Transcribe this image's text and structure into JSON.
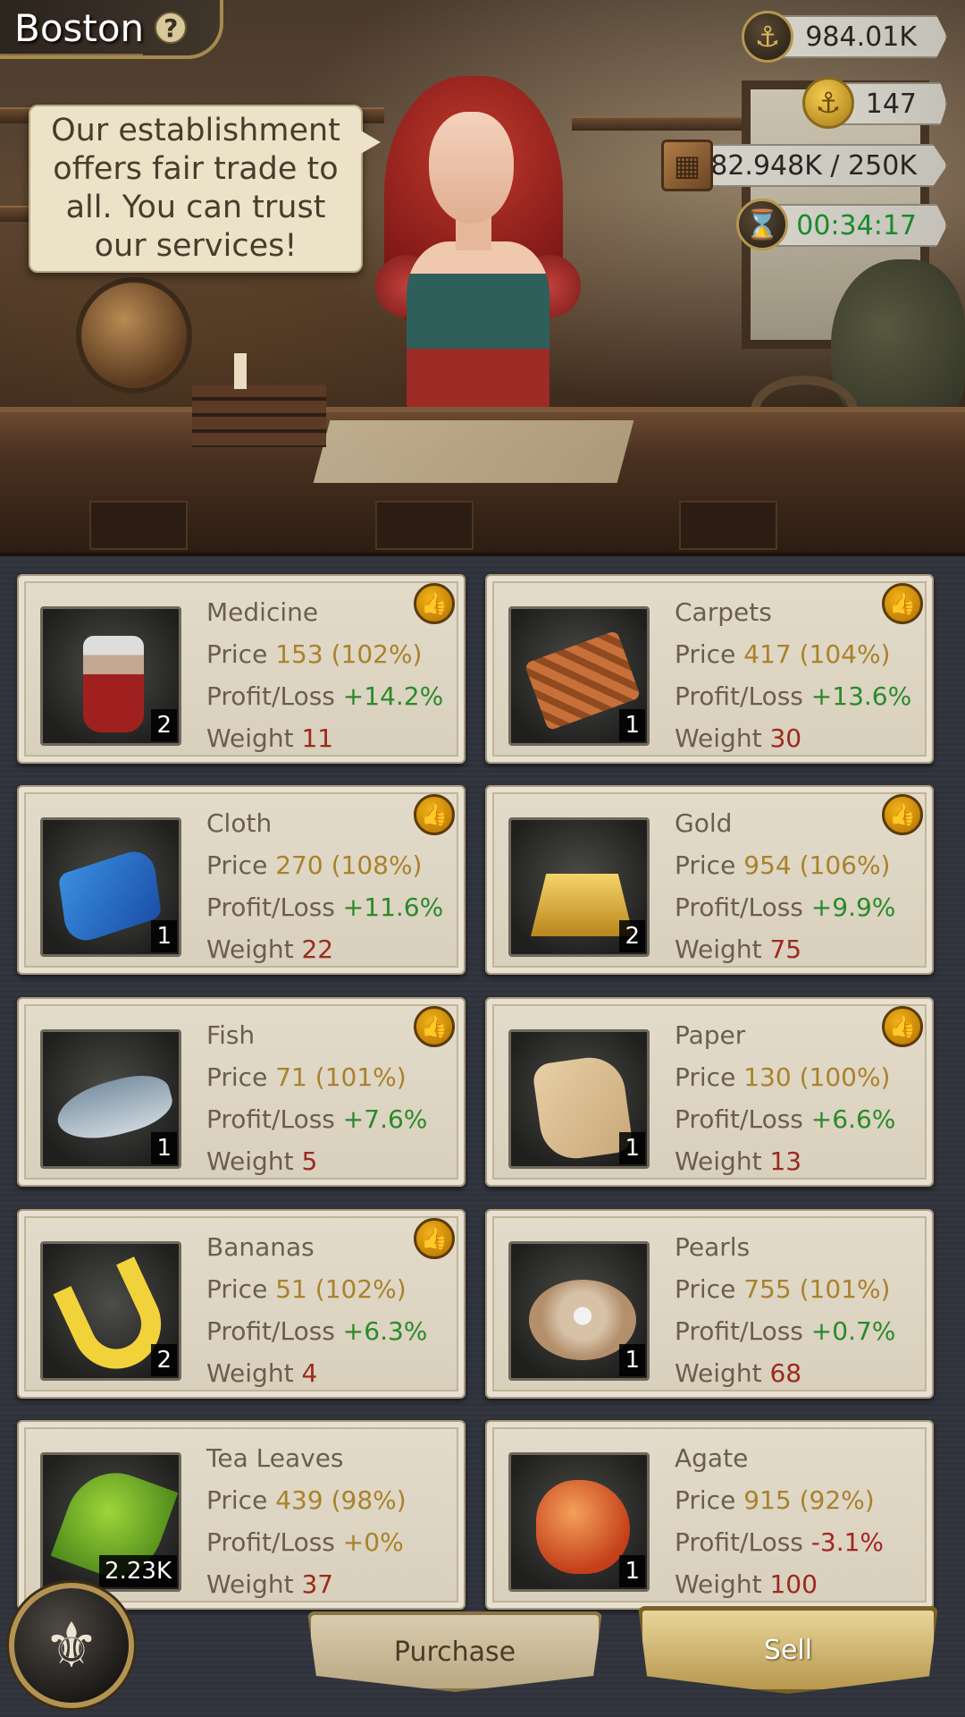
{
  "location": {
    "name": "Boston",
    "help_icon": "help-icon"
  },
  "dialogue": "Our establishment offers fair trade to all. You can trust our services!",
  "resources": {
    "gold": "984.01K",
    "anchor_coins": "147",
    "cargo": "82.948K / 250K",
    "timer": "00:34:17"
  },
  "labels": {
    "price": "Price",
    "profit": "Profit/Loss",
    "weight": "Weight"
  },
  "items": [
    {
      "name": "Medicine",
      "price": "153",
      "pct": "(102%)",
      "profit": "+14.2%",
      "weight": "11",
      "qty": "2",
      "recommended": true
    },
    {
      "name": "Carpets",
      "price": "417",
      "pct": "(104%)",
      "profit": "+13.6%",
      "weight": "30",
      "qty": "1",
      "recommended": true
    },
    {
      "name": "Cloth",
      "price": "270",
      "pct": "(108%)",
      "profit": "+11.6%",
      "weight": "22",
      "qty": "1",
      "recommended": true
    },
    {
      "name": "Gold",
      "price": "954",
      "pct": "(106%)",
      "profit": "+9.9%",
      "weight": "75",
      "qty": "2",
      "recommended": true
    },
    {
      "name": "Fish",
      "price": "71",
      "pct": "(101%)",
      "profit": "+7.6%",
      "weight": "5",
      "qty": "1",
      "recommended": true
    },
    {
      "name": "Paper",
      "price": "130",
      "pct": "(100%)",
      "profit": "+6.6%",
      "weight": "13",
      "qty": "1",
      "recommended": true
    },
    {
      "name": "Bananas",
      "price": "51",
      "pct": "(102%)",
      "profit": "+6.3%",
      "weight": "4",
      "qty": "2",
      "recommended": true
    },
    {
      "name": "Pearls",
      "price": "755",
      "pct": "(101%)",
      "profit": "+0.7%",
      "weight": "68",
      "qty": "1",
      "recommended": false
    },
    {
      "name": "Tea Leaves",
      "price": "439",
      "pct": "(98%)",
      "profit": "+0%",
      "weight": "37",
      "qty": "2.23K",
      "recommended": false
    },
    {
      "name": "Agate",
      "price": "915",
      "pct": "(92%)",
      "profit": "-3.1%",
      "weight": "100",
      "qty": "1",
      "recommended": false
    }
  ],
  "buttons": {
    "purchase": "Purchase",
    "sell": "Sell"
  },
  "colors": {
    "gain": "#2a8a2a",
    "loss": "#a42424",
    "price": "#a8822c",
    "weight": "#9a2a1e"
  }
}
